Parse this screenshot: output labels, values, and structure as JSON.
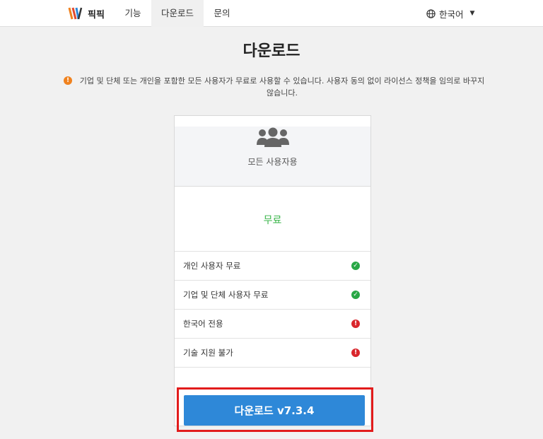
{
  "nav": {
    "brand": "픽픽",
    "items": [
      "기능",
      "다운로드",
      "문의"
    ],
    "language": "한국어"
  },
  "page_title": "다운로드",
  "notice_text": "기업 및 단체 또는 개인을 포함한 모든 사용자가 무료로 사용할 수 있습니다. 사용자 동의 없이 라이선스 정책을 임의로 바꾸지 않습니다.",
  "plan": {
    "label": "모든 사용자용",
    "price": "무료",
    "features": [
      {
        "text": "개인 사용자 무료",
        "status": "check-icon"
      },
      {
        "text": "기업 및 단체 사용자 무료",
        "status": "check-icon"
      },
      {
        "text": "한국어 전용",
        "status": "exclamation-icon"
      },
      {
        "text": "기술 지원 불가",
        "status": "exclamation-icon"
      }
    ]
  },
  "download_label": "다운로드 v7.3.4",
  "colors": {
    "accent": "#2e88d8",
    "success": "#28a745",
    "danger": "#d9262c",
    "warning": "#f0821e",
    "highlight_border": "#e21c1c",
    "price": "#3ab54a"
  }
}
